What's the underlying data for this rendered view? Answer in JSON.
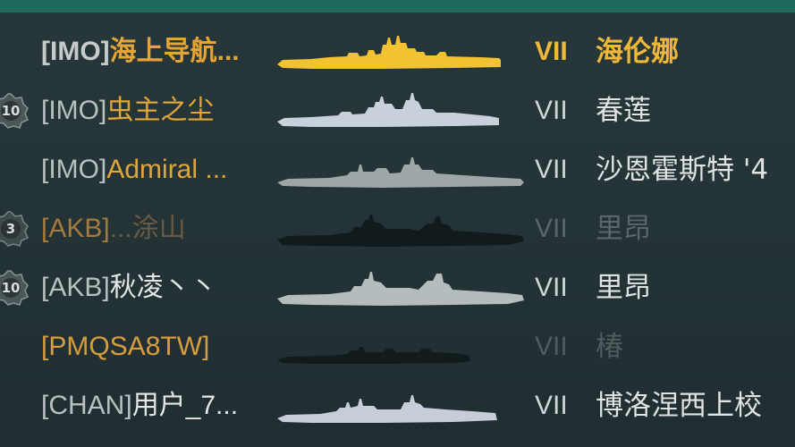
{
  "players": [
    {
      "level": "",
      "clan": "[IMO]",
      "name": "海上导航...",
      "tier": "VII",
      "ship": "海伦娜",
      "ship_color": "#f1c232",
      "status": "self"
    },
    {
      "level": "10",
      "clan": "[IMO]",
      "name": "虫主之尘",
      "tier": "VII",
      "ship": "春莲",
      "ship_color": "#c8d0dc",
      "status": "alive"
    },
    {
      "level": "",
      "clan": "[IMO]",
      "name": "Admiral ...",
      "tier": "VII",
      "ship": "沙恩霍斯特 '4",
      "ship_color": "#9ea6a8",
      "status": "alive"
    },
    {
      "level": "3",
      "clan": "[AKB]",
      "name": "...涂山",
      "tier": "VII",
      "ship": "里昂",
      "ship_color": "#111a1c",
      "status": "dead"
    },
    {
      "level": "10",
      "clan": "[AKB]",
      "name": "秋凌丶丶",
      "tier": "VII",
      "ship": "里昂",
      "ship_color": "#b4bcbe",
      "status": "alive"
    },
    {
      "level": "",
      "clan": "[PMQSA8TW]",
      "name": "",
      "tier": "VII",
      "ship": "椿",
      "ship_color": "#111a1c",
      "status": "dead"
    },
    {
      "level": "",
      "clan": "[CHAN]",
      "name": "用户_7...",
      "tier": "VII",
      "ship": "博洛涅西上校",
      "ship_color": "#c6ccd8",
      "status": "alive"
    }
  ],
  "colors": {
    "self": "#f1c232",
    "ally_name": "#e0a63a",
    "dead": "#5a6668"
  }
}
